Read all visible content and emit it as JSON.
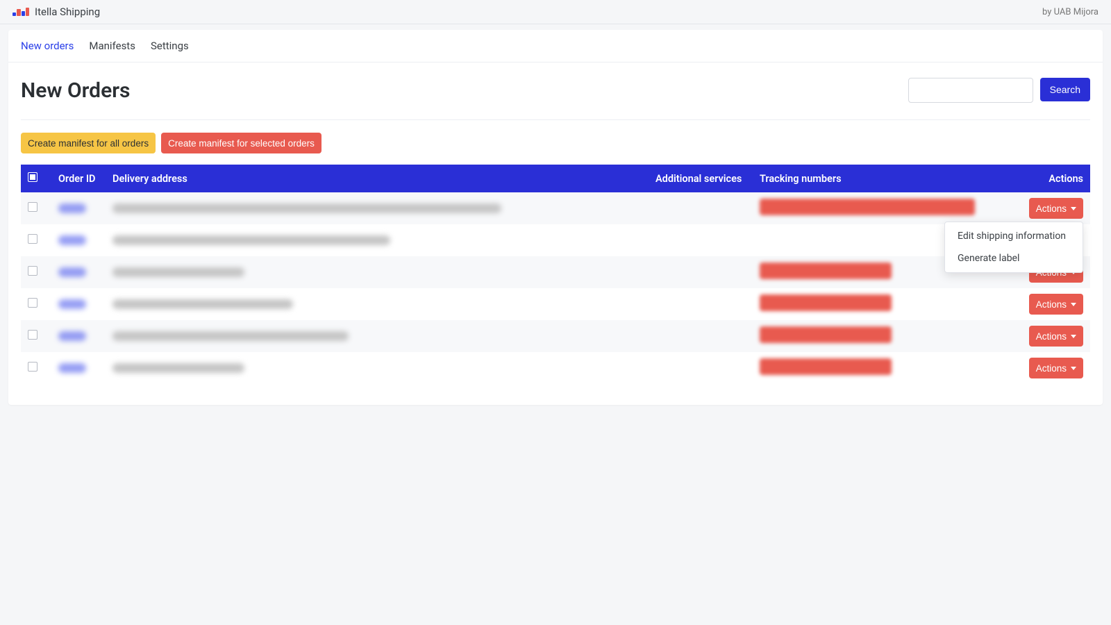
{
  "header": {
    "app_name": "Itella Shipping",
    "credit": "by UAB Mijora"
  },
  "tabs": {
    "new_orders": "New orders",
    "manifests": "Manifests",
    "settings": "Settings",
    "active": "new_orders"
  },
  "page": {
    "title": "New Orders",
    "search_button": "Search",
    "search_value": ""
  },
  "batch_buttons": {
    "manifest_all": "Create manifest for all orders",
    "manifest_selected": "Create manifest for selected orders"
  },
  "table": {
    "headers": {
      "order_id": "Order ID",
      "delivery_address": "Delivery address",
      "additional_services": "Additional services",
      "tracking_numbers": "Tracking numbers",
      "actions": "Actions"
    },
    "action_button_label": "Actions"
  },
  "dropdown": {
    "edit_shipping": "Edit shipping information",
    "generate_label": "Generate label"
  },
  "rows": [
    {
      "addr_w": "w1",
      "track_w": "wA",
      "dropdown_open": true
    },
    {
      "addr_w": "w2",
      "track_w": "",
      "dropdown_open": false
    },
    {
      "addr_w": "w3",
      "track_w": "wB",
      "dropdown_open": false
    },
    {
      "addr_w": "w4",
      "track_w": "wB",
      "dropdown_open": false
    },
    {
      "addr_w": "w5",
      "track_w": "wB",
      "dropdown_open": false
    },
    {
      "addr_w": "w3",
      "track_w": "wB",
      "dropdown_open": false
    }
  ]
}
